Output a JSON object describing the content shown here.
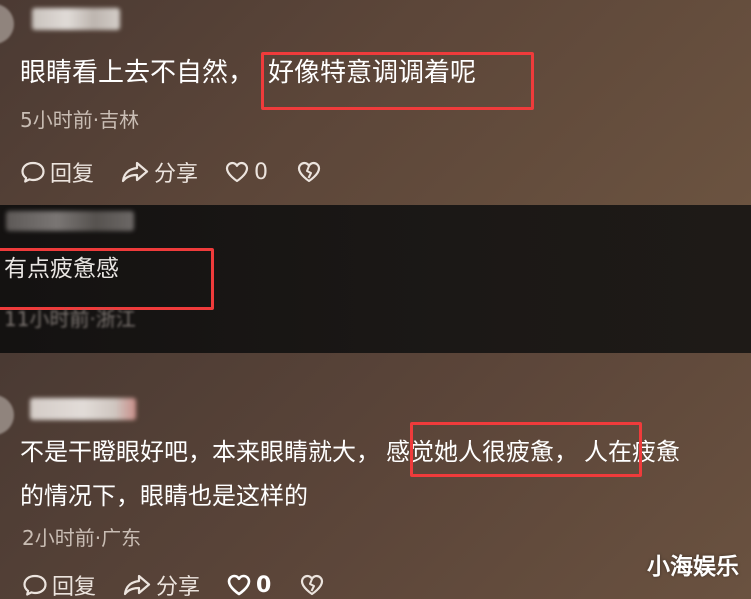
{
  "comments": [
    {
      "text_before": "眼睛看上去不自然，",
      "text_highlight": "好像特意调调着呢",
      "meta": "5小时前·吉林",
      "actions": {
        "reply": "回复",
        "share": "分享",
        "like_count": "0"
      }
    },
    {
      "text_highlight": "有点疲惫感",
      "meta": "11小时前·浙江"
    },
    {
      "text_before": "不是干瞪眼好吧，本来眼睛就大，",
      "text_highlight": "感觉她人很疲惫，",
      "text_after": "人在疲惫",
      "text_line2": "的情况下，眼睛也是这样的",
      "meta": "2小时前·广东",
      "actions": {
        "reply": "回复",
        "share": "分享",
        "like_count": "0"
      }
    }
  ],
  "watermark": "小海娱乐",
  "colors": {
    "highlight_box": "#ef3b3b",
    "text": "#ffffff",
    "meta": "#c9bdb4"
  }
}
